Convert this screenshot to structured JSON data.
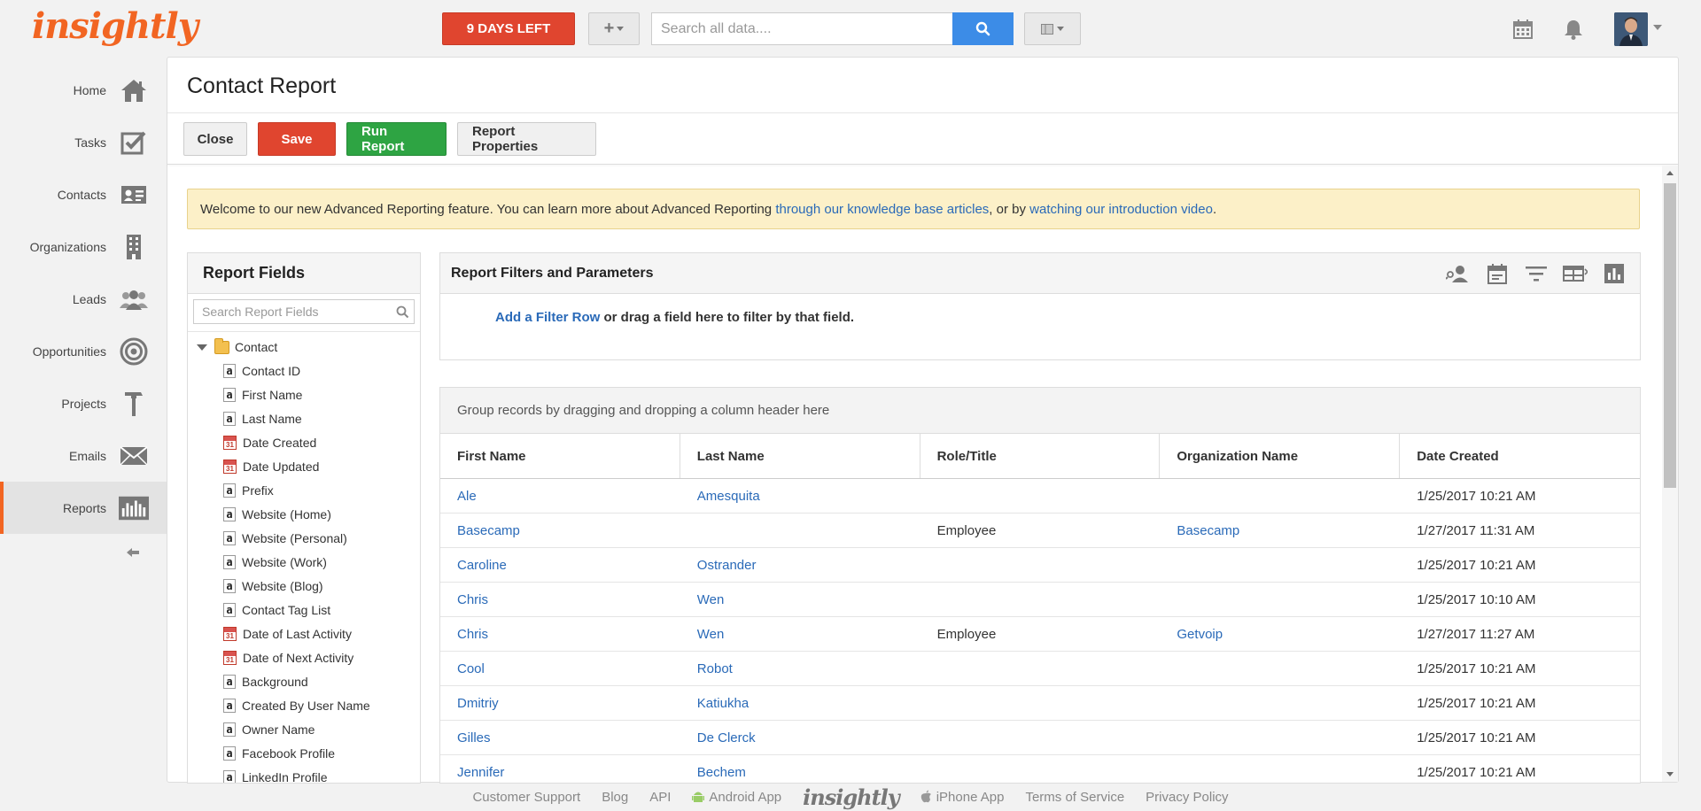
{
  "app": {
    "logo": "insightly"
  },
  "topbar": {
    "trial_label": "9 DAYS LEFT",
    "add_label": "+",
    "search_placeholder": "Search all data...."
  },
  "sidebar": {
    "items": [
      {
        "label": "Home",
        "icon": "home-icon"
      },
      {
        "label": "Tasks",
        "icon": "tasks-icon"
      },
      {
        "label": "Contacts",
        "icon": "contacts-icon"
      },
      {
        "label": "Organizations",
        "icon": "organizations-icon"
      },
      {
        "label": "Leads",
        "icon": "leads-icon"
      },
      {
        "label": "Opportunities",
        "icon": "opportunities-icon"
      },
      {
        "label": "Projects",
        "icon": "projects-icon"
      },
      {
        "label": "Emails",
        "icon": "emails-icon"
      },
      {
        "label": "Reports",
        "icon": "reports-icon",
        "active": true
      }
    ]
  },
  "page": {
    "title": "Contact Report",
    "toolbar": {
      "close": "Close",
      "save": "Save",
      "run": "Run Report",
      "properties": "Report Properties"
    },
    "notice": {
      "text1": "Welcome to our new Advanced Reporting feature. You can learn more about Advanced Reporting ",
      "link1": "through our knowledge base articles",
      "text2": ", or by ",
      "link2": "watching our introduction video",
      "text3": "."
    }
  },
  "fields": {
    "title": "Report Fields",
    "search_placeholder": "Search Report Fields",
    "root": "Contact",
    "items": [
      {
        "label": "Contact ID",
        "type": "text"
      },
      {
        "label": "First Name",
        "type": "text"
      },
      {
        "label": "Last Name",
        "type": "text"
      },
      {
        "label": "Date Created",
        "type": "date"
      },
      {
        "label": "Date Updated",
        "type": "date"
      },
      {
        "label": "Prefix",
        "type": "text"
      },
      {
        "label": "Website (Home)",
        "type": "text"
      },
      {
        "label": "Website (Personal)",
        "type": "text"
      },
      {
        "label": "Website (Work)",
        "type": "text"
      },
      {
        "label": "Website (Blog)",
        "type": "text"
      },
      {
        "label": "Contact Tag List",
        "type": "text"
      },
      {
        "label": "Date of Last Activity",
        "type": "date"
      },
      {
        "label": "Date of Next Activity",
        "type": "date"
      },
      {
        "label": "Background",
        "type": "text"
      },
      {
        "label": "Created By User Name",
        "type": "text"
      },
      {
        "label": "Owner Name",
        "type": "text"
      },
      {
        "label": "Facebook Profile",
        "type": "text"
      },
      {
        "label": "LinkedIn Profile",
        "type": "text"
      }
    ]
  },
  "filters": {
    "title": "Report Filters and Parameters",
    "add_link": "Add a Filter Row",
    "add_text": " or drag a field here to filter by that field."
  },
  "grid": {
    "group_hint": "Group records by dragging and dropping a column header here",
    "columns": [
      "First Name",
      "Last Name",
      "Role/Title",
      "Organization Name",
      "Date Created"
    ],
    "rows": [
      [
        "Ale",
        "Amesquita",
        "",
        "",
        "1/25/2017 10:21 AM"
      ],
      [
        "Basecamp",
        "",
        "Employee",
        "Basecamp",
        "1/27/2017 11:31 AM"
      ],
      [
        "Caroline",
        "Ostrander",
        "",
        "",
        "1/25/2017 10:21 AM"
      ],
      [
        "Chris",
        "Wen",
        "",
        "",
        "1/25/2017 10:10 AM"
      ],
      [
        "Chris",
        "Wen",
        "Employee",
        "Getvoip",
        "1/27/2017 11:27 AM"
      ],
      [
        "Cool",
        "Robot",
        "",
        "",
        "1/25/2017 10:21 AM"
      ],
      [
        "Dmitriy",
        "Katiukha",
        "",
        "",
        "1/25/2017 10:21 AM"
      ],
      [
        "Gilles",
        "De Clerck",
        "",
        "",
        "1/25/2017 10:21 AM"
      ],
      [
        "Jennifer",
        "Bechem",
        "",
        "",
        "1/25/2017 10:21 AM"
      ]
    ]
  },
  "footer": {
    "links": [
      "Customer Support",
      "Blog",
      "API",
      "Android App",
      "iPhone App",
      "Terms of Service",
      "Privacy Policy"
    ],
    "logo": "insightly"
  },
  "colors": {
    "brand": "#f26522",
    "save": "#e0452f",
    "run": "#2ea443",
    "link": "#2a6ab8",
    "search": "#3c8ce7"
  }
}
